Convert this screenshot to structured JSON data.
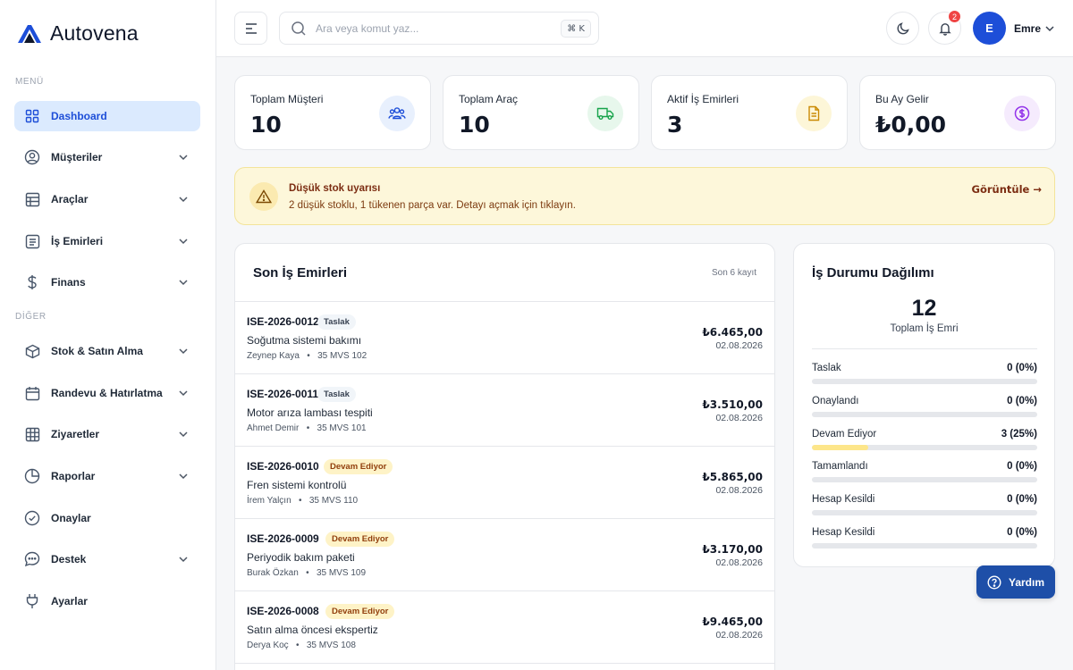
{
  "app": {
    "name": "Autovena"
  },
  "sidebar": {
    "section_menu": "MENÜ",
    "section_other": "DİĞER",
    "items": [
      {
        "label": "Dashboard",
        "icon": "grid-icon",
        "active": true
      },
      {
        "label": "Müşteriler",
        "icon": "user-circle-icon"
      },
      {
        "label": "Araçlar",
        "icon": "table-icon"
      },
      {
        "label": "İş Emirleri",
        "icon": "list-icon"
      },
      {
        "label": "Finans",
        "icon": "dollar-icon"
      },
      {
        "label": "Stok & Satın Alma",
        "icon": "box-icon"
      },
      {
        "label": "Randevu & Hatırlatma",
        "icon": "calendar-icon"
      },
      {
        "label": "Ziyaretler",
        "icon": "grid-table-icon"
      },
      {
        "label": "Raporlar",
        "icon": "pie-chart-icon"
      },
      {
        "label": "Onaylar",
        "icon": "check-circle-icon"
      },
      {
        "label": "Destek",
        "icon": "chat-icon"
      },
      {
        "label": "Ayarlar",
        "icon": "plug-icon"
      }
    ]
  },
  "header": {
    "search_placeholder": "Ara veya komut yaz...",
    "shortcut": "⌘ K",
    "notification_count": "2",
    "user_initial": "E",
    "user_name": "Emre"
  },
  "stats": [
    {
      "title": "Toplam Müşteri",
      "value": "10",
      "icon": "users-icon",
      "color": "#1d4ed8",
      "bg": "#e8f0fd"
    },
    {
      "title": "Toplam Araç",
      "value": "10",
      "icon": "truck-icon",
      "color": "#16a34a",
      "bg": "#e7f7ec"
    },
    {
      "title": "Aktif İş Emirleri",
      "value": "3",
      "icon": "document-icon",
      "color": "#ca8a04",
      "bg": "#fdf6d8"
    },
    {
      "title": "Bu Ay Gelir",
      "value": "₺0,00",
      "icon": "dollar-circle-icon",
      "color": "#9333ea",
      "bg": "#f5ebfd"
    }
  ],
  "alert": {
    "title": "Düşük stok uyarısı",
    "description": "2 düşük stoklu, 1 tükenen parça var. Detayı açmak için tıklayın.",
    "link": "Görüntüle →"
  },
  "work_orders": {
    "title": "Son İş Emirleri",
    "count_label": "Son 6 kayıt",
    "rows": [
      {
        "code": "ISE-2026-0012",
        "status": "Taslak",
        "status_type": "draft",
        "desc": "Soğutma sistemi bakımı",
        "customer": "Zeynep Kaya",
        "plate": "35 MVS 102",
        "amount": "₺6.465,00",
        "date": "02.08.2026"
      },
      {
        "code": "ISE-2026-0011",
        "status": "Taslak",
        "status_type": "draft",
        "desc": "Motor arıza lambası tespiti",
        "customer": "Ahmet Demir",
        "plate": "35 MVS 101",
        "amount": "₺3.510,00",
        "date": "02.08.2026"
      },
      {
        "code": "ISE-2026-0010",
        "status": "Devam Ediyor",
        "status_type": "progress",
        "desc": "Fren sistemi kontrolü",
        "customer": "İrem Yalçın",
        "plate": "35 MVS 110",
        "amount": "₺5.865,00",
        "date": "02.08.2026"
      },
      {
        "code": "ISE-2026-0009",
        "status": "Devam Ediyor",
        "status_type": "progress",
        "desc": "Periyodik bakım paketi",
        "customer": "Burak Özkan",
        "plate": "35 MVS 109",
        "amount": "₺3.170,00",
        "date": "02.08.2026"
      },
      {
        "code": "ISE-2026-0008",
        "status": "Devam Ediyor",
        "status_type": "progress",
        "desc": "Satın alma öncesi ekspertiz",
        "customer": "Derya Koç",
        "plate": "35 MVS 108",
        "amount": "₺9.465,00",
        "date": "02.08.2026"
      }
    ]
  },
  "distribution": {
    "title": "İş Durumu Dağılımı",
    "total": "12",
    "total_label": "Toplam İş Emri",
    "rows": [
      {
        "label": "Taslak",
        "value": "0 (0%)",
        "pct": 0
      },
      {
        "label": "Onaylandı",
        "value": "0 (0%)",
        "pct": 0
      },
      {
        "label": "Devam Ediyor",
        "value": "3 (25%)",
        "pct": 25,
        "color": "#fde68a"
      },
      {
        "label": "Tamamlandı",
        "value": "0 (0%)",
        "pct": 0
      },
      {
        "label": "Hesap Kesildi",
        "value": "0 (0%)",
        "pct": 0
      },
      {
        "label": "Hesap Kesildi",
        "value": "0 (0%)",
        "pct": 0
      }
    ]
  },
  "help": {
    "label": "Yardım"
  }
}
